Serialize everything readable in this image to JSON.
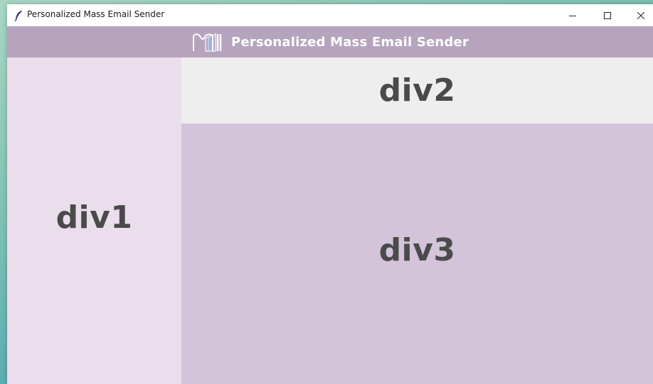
{
  "window": {
    "title": "Personalized Mass Email Sender",
    "app_icon": "feather-icon",
    "controls": {
      "minimize_icon": "minimize-icon",
      "maximize_icon": "maximize-icon",
      "close_icon": "close-icon"
    }
  },
  "header": {
    "title": "Personalized Mass Email Sender",
    "logo_icon": "pm-logo-icon",
    "background": "#b6a4bf",
    "text_color": "#ffffff"
  },
  "panels": {
    "div1": {
      "label": "div1",
      "background": "#eadeec"
    },
    "div2": {
      "label": "div2",
      "background": "#efeeef"
    },
    "div3": {
      "label": "div3",
      "background": "#d3c4da"
    }
  }
}
